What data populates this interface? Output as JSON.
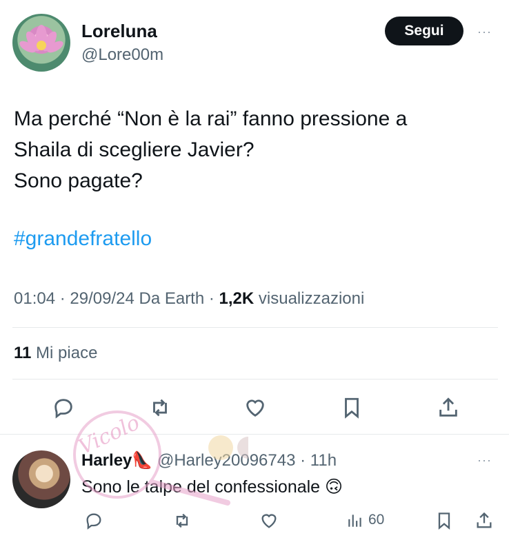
{
  "tweet": {
    "author": {
      "display_name": "Loreluna",
      "handle": "@Lore00m"
    },
    "follow_label": "Segui",
    "more_label": "···",
    "text_lines": [
      "Ma perché “Non è la rai” fanno pressione a",
      "Shaila di scegliere Javier?",
      "Sono pagate?"
    ],
    "hashtag": "#grandefratello",
    "meta": {
      "time": "01:04",
      "date": "29/09/24",
      "source": "Da Earth",
      "views_count": "1,2K",
      "views_label": "visualizzazioni"
    },
    "likes": {
      "count": "11",
      "label": "Mi piace"
    },
    "actions": [
      "reply-icon",
      "retweet-icon",
      "like-icon",
      "bookmark-icon",
      "share-icon"
    ]
  },
  "reply": {
    "display_name": "Harley",
    "emoji": "👠",
    "handle": "@Harley20096743",
    "time": "11h",
    "text": "Sono le talpe del confessionale 🙃",
    "views": "60",
    "more_label": "···",
    "actions": [
      "reply-icon",
      "retweet-icon",
      "like-icon",
      "views-icon",
      "bookmark-icon",
      "share-icon"
    ]
  },
  "watermark_text": "Vicolo"
}
